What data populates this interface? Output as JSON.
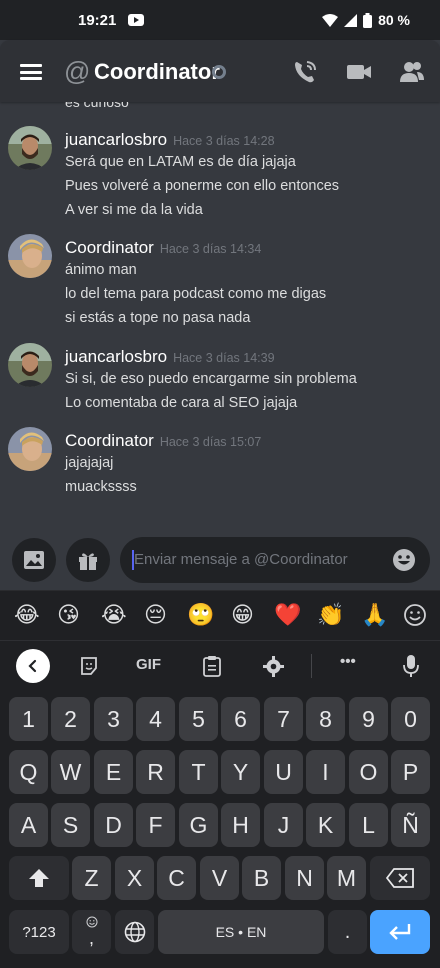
{
  "statusbar": {
    "time": "19:21",
    "battery": "80 %"
  },
  "header": {
    "at_symbol": "@",
    "title": "Coordinator"
  },
  "chat": {
    "cutoff_text": "es curioso",
    "messages": [
      {
        "author": "juancarlosbro",
        "timestamp": "Hace 3 días 14:28",
        "avatar": "bearded-man",
        "lines": [
          "Será que en LATAM es de día jajaja",
          "Pues volveré a ponerme con ello entonces",
          "A ver si me da la vida"
        ]
      },
      {
        "author": "Coordinator",
        "timestamp": "Hace 3 días 14:34",
        "avatar": "blond-man",
        "lines": [
          "ánimo man",
          "lo del tema para podcast como me digas",
          "si estás a tope no pasa nada"
        ]
      },
      {
        "author": "juancarlosbro",
        "timestamp": "Hace 3 días 14:39",
        "avatar": "bearded-man",
        "lines": [
          "Si si, de eso puedo encargarme sin problema",
          "Lo comentaba de cara al SEO jajaja"
        ]
      },
      {
        "author": "Coordinator",
        "timestamp": "Hace 3 días 15:07",
        "avatar": "blond-man",
        "lines": [
          "jajajajaj",
          "muackssss"
        ]
      }
    ]
  },
  "composer": {
    "placeholder": "Enviar mensaje a @Coordinator"
  },
  "emoji_suggestions": [
    "😂",
    "😘",
    "😭",
    "😔",
    "🙄",
    "😁",
    "❤️",
    "👏",
    "🙏"
  ],
  "keyboard": {
    "gif_label": "GIF",
    "more_label": "•••",
    "rows": [
      [
        "1",
        "2",
        "3",
        "4",
        "5",
        "6",
        "7",
        "8",
        "9",
        "0"
      ],
      [
        "Q",
        "W",
        "E",
        "R",
        "T",
        "Y",
        "U",
        "I",
        "O",
        "P"
      ],
      [
        "A",
        "S",
        "D",
        "F",
        "G",
        "H",
        "J",
        "K",
        "L",
        "Ñ"
      ],
      [
        "Z",
        "X",
        "C",
        "V",
        "B",
        "N",
        "M"
      ]
    ],
    "symbols_label": "?123",
    "comma_label": ",",
    "space_label": "ES • EN",
    "period_label": "."
  },
  "colors": {
    "background": "#36393f",
    "header": "#2f3136",
    "input": "#202225",
    "accent": "#5865f2",
    "keyboard": "#1f2023",
    "key": "#3c3d41",
    "enter_key": "#4aa3ff"
  }
}
